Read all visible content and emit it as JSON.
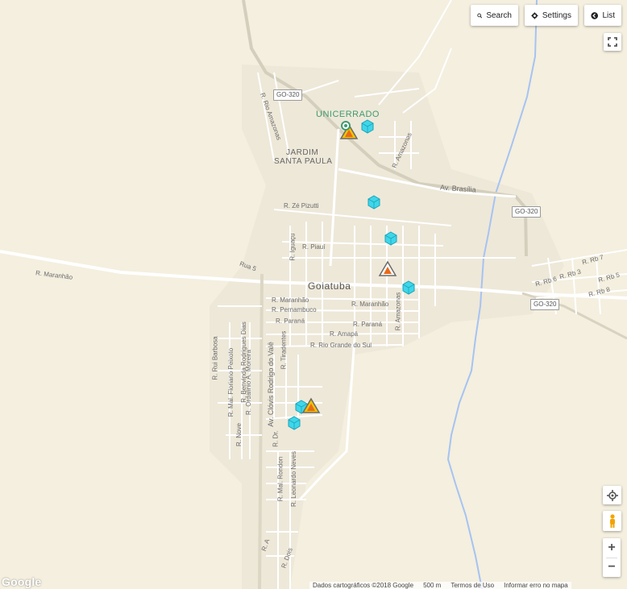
{
  "controls": {
    "search_label": "Search",
    "settings_label": "Settings",
    "list_label": "List"
  },
  "map": {
    "city_label": "Goiatuba",
    "poi_label": "UNICERRADO",
    "neighborhood_line1": "JARDIM",
    "neighborhood_line2": "SANTA PAULA",
    "highway_shields": [
      "GO-320",
      "GO-320",
      "GO-320"
    ],
    "streets": {
      "av_brasilia": "Av. Brasília",
      "r_maranhao_west": "R. Maranhão",
      "r_ze_pizutti": "R. Zé Pizutti",
      "r_iguacu": "R. Iguaçu",
      "r_piaui": "R. Piauí",
      "rua_5": "Rua 5",
      "r_rio_amazonas": "R. Rio Amazonas",
      "r_amazonas_north": "R. Amazonas",
      "r_maranhao_1": "R. Maranhão",
      "r_pernambuco": "R. Pernambuco",
      "r_parana_1": "R. Paraná",
      "r_maranhao_2": "R. Maranhão",
      "r_parana_2": "R. Paraná",
      "r_amapa": "R. Amapá",
      "r_rio_grande_do_sul": "R. Rio Grande do Sul",
      "r_amazonas_south": "R. Amazonas",
      "r_tiradentes": "R. Tiradentes",
      "r_rui_barbosa": "R. Rui Barbosa",
      "r_benvinda": "R. Benvinda Rodrigues Dias",
      "r_mal_floriano": "R. Mal. Floriano Peixoto",
      "r_ordalinio": "R. Ordalinio A. Moreira",
      "av_clovis": "Av. Clóvis Rodrigo do Valê",
      "r_nove": "R. Nove",
      "r_dr": "R. Dr.",
      "r_mal_rondon": "R. Mal. Rondon",
      "r_leonardo": "R. Leonardo Neves",
      "r_a": "R. A",
      "r_dois": "R. Dois",
      "r_rb7": "R. Rb 7",
      "r_rb3": "R. Rb 3",
      "r_rb5": "R. Rb 5",
      "r_rb6": "R. Rb 6",
      "r_rb8": "R. Rb 8"
    }
  },
  "markers": {
    "cube_count": 6,
    "warning_count": 3
  },
  "footer": {
    "map_data": "Dados cartográficos ©2018 Google",
    "scale": "500 m",
    "terms": "Termos de Uso",
    "report": "Informar erro no mapa"
  },
  "google_logo_text": "Google",
  "colors": {
    "land": "#f4efdf",
    "road": "#ffffff",
    "river": "#a6c3f2",
    "marker_cube": "#3fd6ea",
    "marker_warning": "#f2c200",
    "poi_text": "#3f9b6f"
  }
}
